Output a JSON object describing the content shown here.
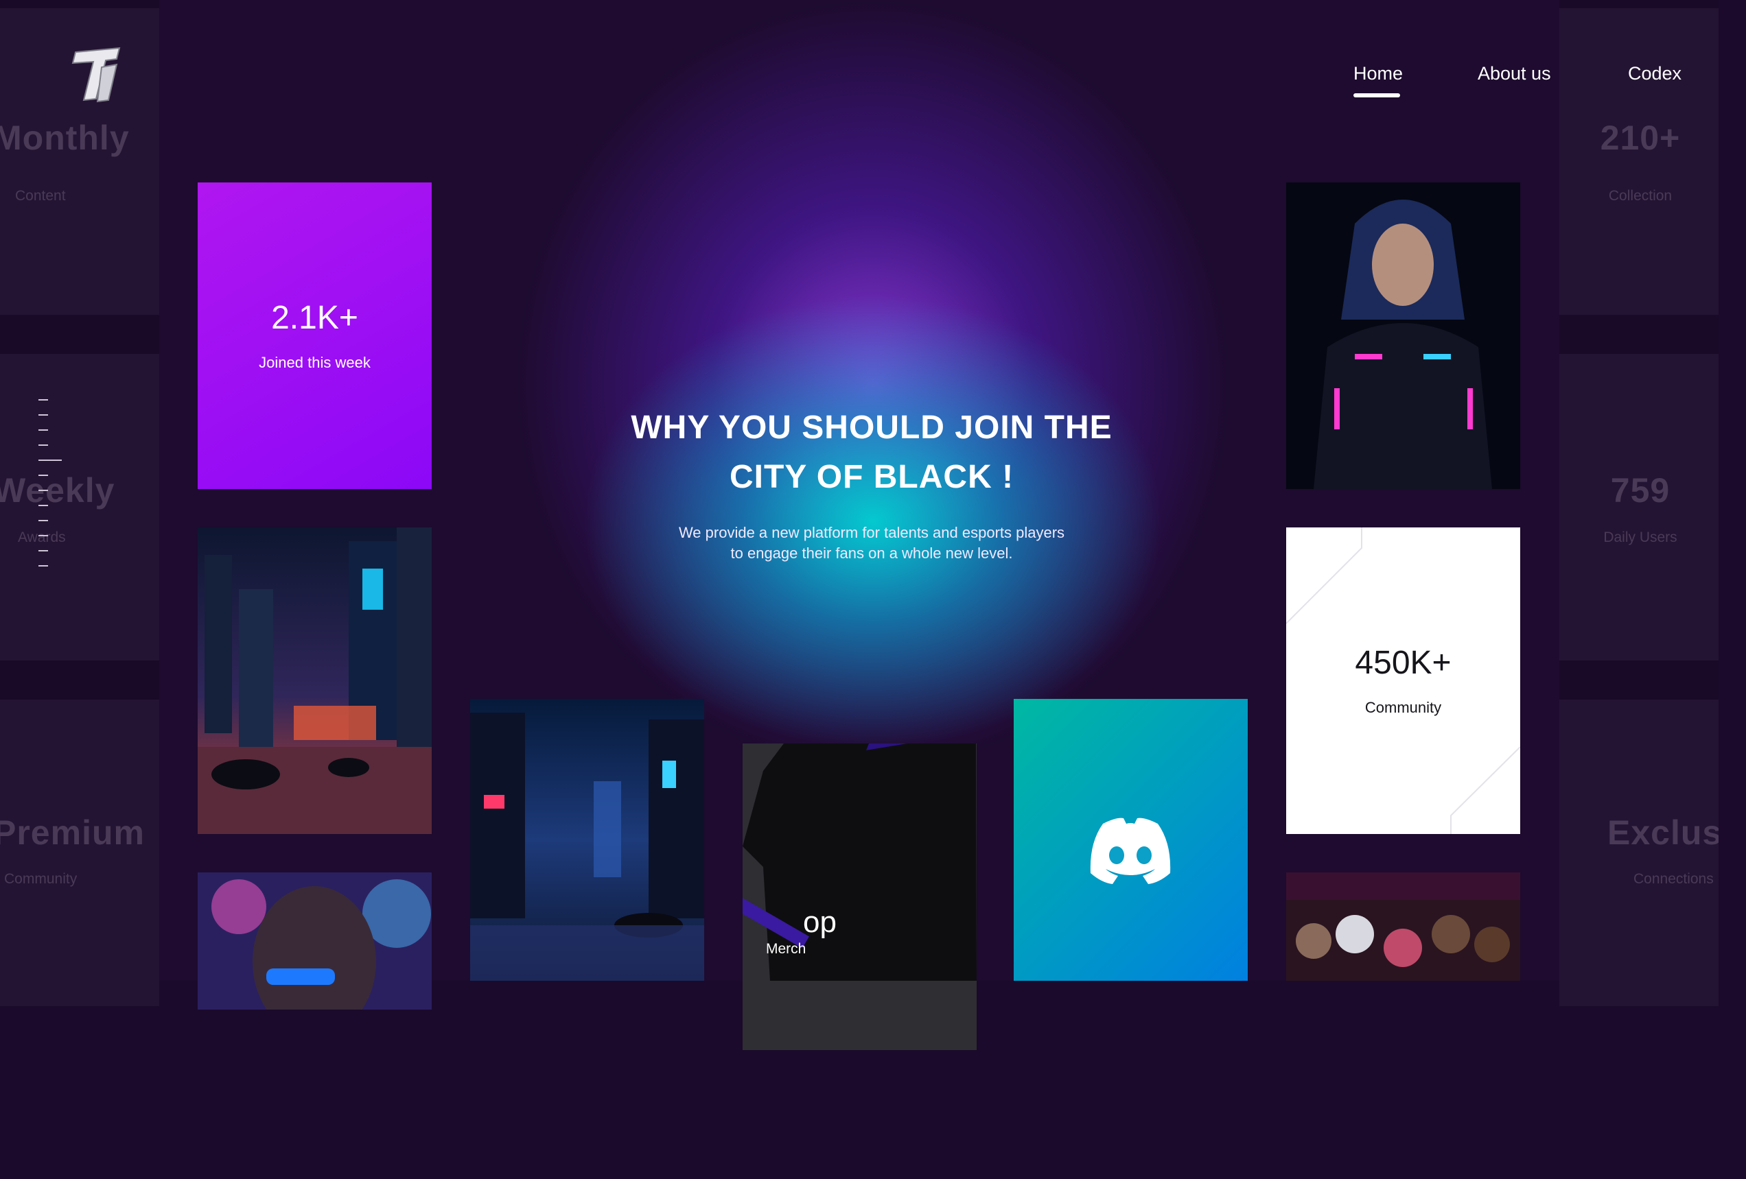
{
  "nav": {
    "home": "Home",
    "about": "About us",
    "codex": "Codex"
  },
  "hero": {
    "title_line1": "WHY YOU SHOULD JOIN THE",
    "title_line2": "CITY OF BLACK !",
    "subtitle_line1": "We provide a new platform for talents and esports players",
    "subtitle_line2": "to engage their fans on a whole new level."
  },
  "stats": {
    "joined": {
      "value": "2.1K+",
      "label": "Joined this week"
    },
    "community": {
      "value": "450K+",
      "label": "Community"
    }
  },
  "side_left": [
    {
      "big": "Monthly",
      "small": "Content"
    },
    {
      "big": "Weekly",
      "small": "Awards"
    },
    {
      "big": "Premium",
      "small": "Community"
    }
  ],
  "side_right": [
    {
      "big": "210+",
      "small": "Collection"
    },
    {
      "big": "759",
      "small": "Daily Users"
    },
    {
      "big": "Exclusive",
      "small": "Connections"
    }
  ],
  "merch": {
    "big": "op",
    "small": "Merch"
  },
  "colors": {
    "bg": "#1b0a2b",
    "purple_tile": "#9a10f3",
    "discord_from": "#00b8a2",
    "discord_to": "#0080e0"
  },
  "icons": {
    "logo": "t1-logo-icon",
    "discord": "discord-icon"
  }
}
